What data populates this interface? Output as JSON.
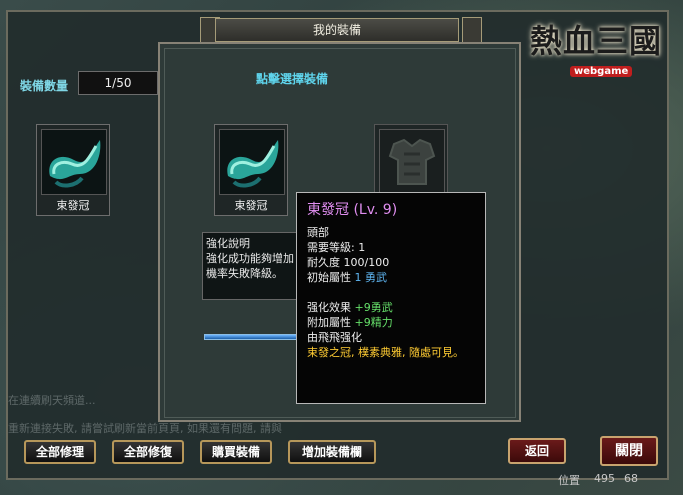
{
  "window": {
    "title": "我的裝備"
  },
  "logo": {
    "text": "熱血三國",
    "sub": "webgame"
  },
  "equipment": {
    "count_label": "裝備數量",
    "count_value": "1/50",
    "slot_item_name": "束發冠"
  },
  "dialog": {
    "title": "點擊選擇裝備",
    "selected_item_name": "束發冠",
    "desc_lines": [
      "強化說明",
      "強化成功能夠增加",
      "機率失敗降級。"
    ]
  },
  "tooltip": {
    "title": "東發冠 (Lv. 9)",
    "slot": "頭部",
    "req_level": "需要等級: 1",
    "durability": "耐久度  100/100",
    "base_attr_label": "初始屬性",
    "base_attr_value": "1 勇武",
    "enhance_label": "强化效果",
    "enhance_value": "+9勇武",
    "extra_label": "附加屬性",
    "extra_value": "+9精力",
    "source": "由飛飛强化",
    "flavor": "束發之冠, 樸素典雅, 隨處可見。"
  },
  "buttons": {
    "repair_all": "全部修理",
    "restore_all": "全部修復",
    "buy_equipment": "購買裝備",
    "add_slots": "增加裝備欄",
    "back": "返回",
    "close": "關閉"
  },
  "background": {
    "faint_texts": [
      "在連續刷天頻道...",
      "重新連接失敗, 請嘗試刷新當前頁頁, 如果還有問題, 請與"
    ],
    "coord_label": "位置",
    "coord_x": "495",
    "coord_y": "68"
  },
  "colors": {
    "accent_cyan": "#5fd4ec",
    "tooltip_title": "#e08ef0",
    "attr_green": "#66e06a",
    "attr_blue": "#5fb6f2",
    "flavor_yellow": "#ffcc33"
  }
}
